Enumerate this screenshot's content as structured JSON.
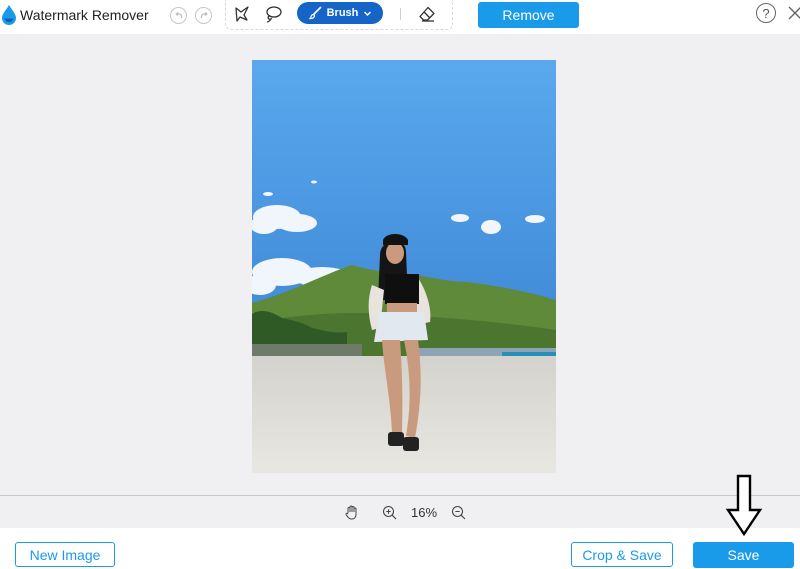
{
  "app": {
    "title": "Watermark Remover",
    "logo_icon": "water-drop-icon"
  },
  "toolbar": {
    "undo_icon": "undo-icon",
    "redo_icon": "redo-icon",
    "tools": [
      {
        "name": "polygonal-lasso",
        "icon": "polygon-lasso-icon"
      },
      {
        "name": "lasso",
        "icon": "lasso-icon"
      },
      {
        "name": "brush",
        "icon": "brush-icon",
        "label": "Brush",
        "selected": true
      },
      {
        "name": "eraser",
        "icon": "eraser-icon"
      }
    ],
    "remove_label": "Remove",
    "help_label": "?",
    "accent_color": "#1a9bea",
    "brush_color": "#1565c8"
  },
  "zoom": {
    "level": "16%",
    "hand_icon": "hand-icon",
    "zoom_in_icon": "zoom-in-icon",
    "zoom_out_icon": "zoom-out-icon"
  },
  "actions": {
    "new_image_label": "New Image",
    "crop_save_label": "Crop & Save",
    "save_label": "Save"
  },
  "annotation": {
    "icon": "down-arrow-icon",
    "points_to": "Save"
  }
}
